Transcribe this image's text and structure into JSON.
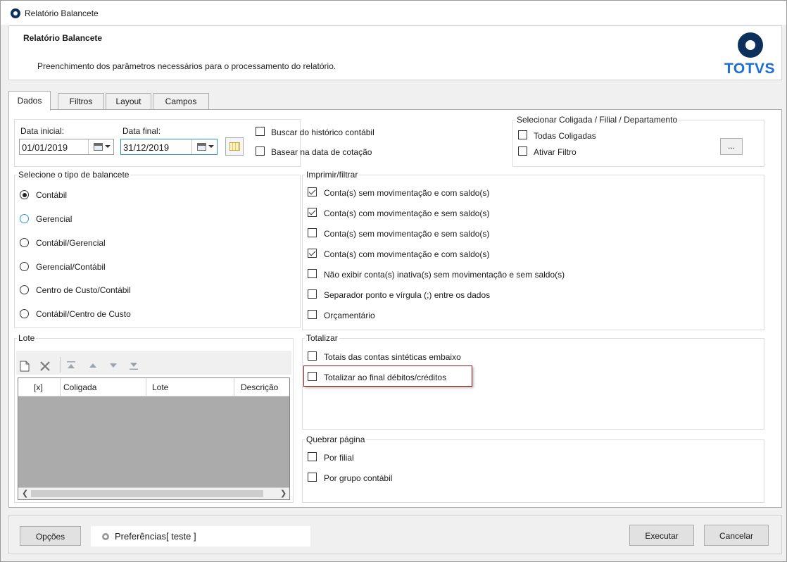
{
  "window": {
    "title": "Relatório Balancete"
  },
  "header": {
    "title": "Relatório Balancete",
    "description": "Preenchimento dos parâmetros necessários para o processamento do relatório.",
    "logo_text": "TOTVS"
  },
  "tabs": [
    {
      "label": "Dados",
      "active": true
    },
    {
      "label": "Filtros"
    },
    {
      "label": "Layout"
    },
    {
      "label": "Campos"
    }
  ],
  "dates": {
    "start_label": "Data inicial:",
    "start_value": "01/01/2019",
    "end_label": "Data final:",
    "end_value": "31/12/2019"
  },
  "options": {
    "historico": {
      "label": "Buscar do histórico contábil",
      "checked": false
    },
    "cotacao": {
      "label": "Basear na data de cotação",
      "checked": false
    }
  },
  "coligada": {
    "title": "Selecionar Coligada / Filial / Departamento",
    "todas": {
      "label": "Todas Coligadas",
      "checked": false
    },
    "filtro": {
      "label": "Ativar Filtro",
      "checked": false
    },
    "browse_label": "..."
  },
  "tipo_balancete": {
    "title": "Selecione o tipo de balancete",
    "options": [
      {
        "label": "Contábil",
        "selected": true
      },
      {
        "label": "Gerencial",
        "selected": false
      },
      {
        "label": "Contábil/Gerencial",
        "selected": false
      },
      {
        "label": "Gerencial/Contábil",
        "selected": false
      },
      {
        "label": "Centro de Custo/Contábil",
        "selected": false
      },
      {
        "label": "Contábil/Centro de Custo",
        "selected": false
      }
    ]
  },
  "imprimir": {
    "title": "Imprimir/filtrar",
    "items": [
      {
        "label": "Conta(s) sem movimentação e com saldo(s)",
        "checked": true
      },
      {
        "label": "Conta(s) com movimentação e sem saldo(s)",
        "checked": true
      },
      {
        "label": "Conta(s) sem movimentação e sem saldo(s)",
        "checked": false
      },
      {
        "label": "Conta(s) com movimentação e com saldo(s)",
        "checked": true
      },
      {
        "label": "Não exibir conta(s) inativa(s) sem movimentação e sem saldo(s)",
        "checked": false
      },
      {
        "label": "Separador ponto e vírgula (;) entre os dados",
        "checked": false
      },
      {
        "label": "Orçamentário",
        "checked": false
      }
    ]
  },
  "lote": {
    "title": "Lote",
    "columns": [
      "[x]",
      "Coligada",
      "Lote",
      "Descrição"
    ],
    "toolbar_icons": [
      "new-icon",
      "delete-icon",
      "move-top-icon",
      "move-up-icon",
      "move-down-icon",
      "move-bottom-icon"
    ]
  },
  "totalizar": {
    "title": "Totalizar",
    "items": [
      {
        "label": "Totais das contas sintéticas embaixo",
        "checked": false
      },
      {
        "label": "Totalizar ao final débitos/créditos",
        "checked": false
      }
    ]
  },
  "quebrar": {
    "title": "Quebrar página",
    "items": [
      {
        "label": "Por filial",
        "checked": false
      },
      {
        "label": "Por grupo contábil",
        "checked": false
      }
    ]
  },
  "footer": {
    "options_label": "Opções",
    "preferences_label": "Preferências[ teste ]",
    "execute_label": "Executar",
    "cancel_label": "Cancelar"
  },
  "colors": {
    "logo_dark": "#0d2f5c",
    "logo_text": "#1d6fd8",
    "highlight_border": "#8b1a1a",
    "focus_border": "#2f8fd8",
    "grid_background": "#ababab"
  }
}
